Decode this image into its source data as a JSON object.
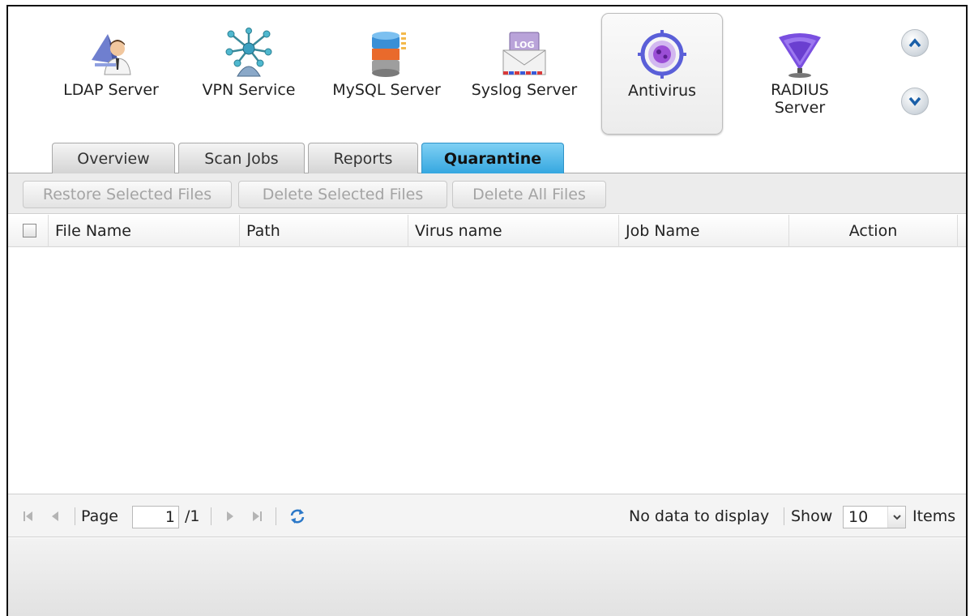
{
  "apps": [
    {
      "label": "LDAP Server",
      "icon": "ldap-server-icon"
    },
    {
      "label": "VPN Service",
      "icon": "vpn-service-icon"
    },
    {
      "label": "MySQL Server",
      "icon": "mysql-server-icon"
    },
    {
      "label": "Syslog Server",
      "icon": "syslog-server-icon"
    },
    {
      "label": "Antivirus",
      "icon": "antivirus-icon",
      "selected": true
    },
    {
      "label": "RADIUS\nServer",
      "icon": "radius-server-icon"
    }
  ],
  "syslog_badge": "LOG",
  "tabs": [
    "Overview",
    "Scan Jobs",
    "Reports",
    "Quarantine"
  ],
  "active_tab": "Quarantine",
  "toolbar": {
    "restore_label": "Restore Selected Files",
    "delete_label": "Delete Selected Files",
    "delete_all_label": "Delete All Files"
  },
  "grid": {
    "columns": [
      "File Name",
      "Path",
      "Virus name",
      "Job Name",
      "Action"
    ],
    "rows": []
  },
  "pager": {
    "page_label": "Page",
    "page_value": "1",
    "page_total": "/1",
    "status": "No data to display",
    "show_label": "Show",
    "page_size": "10",
    "items_label": "Items"
  },
  "colors": {
    "active_tab": "#35a7e0",
    "disabled_text": "#a4a4a4"
  }
}
